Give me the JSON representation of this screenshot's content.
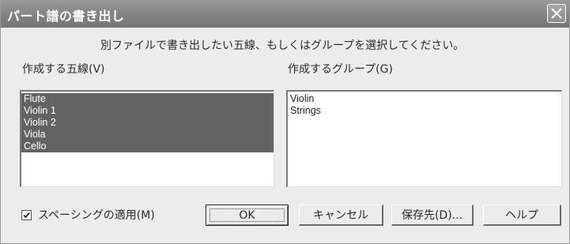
{
  "dialog": {
    "title": "パート譜の書き出し",
    "instruction": "別ファイルで書き出したい五線、もしくはグループを選択してください。"
  },
  "staves": {
    "label": "作成する五線(V)",
    "items": [
      "Flute",
      "Violin 1",
      "Violin 2",
      "Viola",
      "Cello"
    ]
  },
  "groups": {
    "label": "作成するグループ(G)",
    "items": [
      "Violin",
      "Strings"
    ]
  },
  "options": {
    "spacing_label": "スペーシングの適用(M)",
    "spacing_checked": true
  },
  "buttons": {
    "ok": "OK",
    "cancel": "キャンセル",
    "save_location": "保存先(D)...",
    "help": "ヘルプ"
  },
  "icons": {
    "close": "close-icon",
    "check": "checkmark-icon"
  },
  "colors": {
    "titlebar": "#828282",
    "selection": "#636363",
    "window": "#ececec"
  }
}
